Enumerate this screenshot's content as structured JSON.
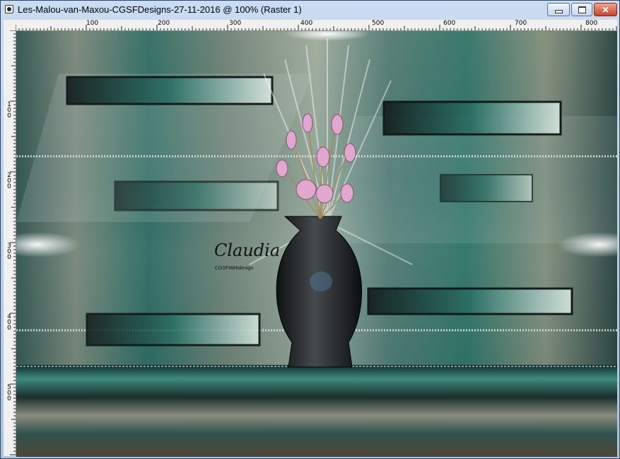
{
  "window": {
    "title": "Les-Malou-van-Maxou-CGSFDesigns-27-11-2016 @ 100% (Raster 1)",
    "minimize_label": "",
    "maximize_label": "",
    "close_label": "✕"
  },
  "ruler": {
    "top_labels": [
      "100",
      "200",
      "300",
      "400",
      "500",
      "600",
      "700",
      "800"
    ],
    "left_labels": [
      "100",
      "200",
      "300",
      "400",
      "500"
    ]
  },
  "artwork": {
    "signature": "Claudia",
    "signature_sub": "CGSFWebdesign",
    "colors": {
      "teal": "#2d6e66",
      "beige": "#b5aa92",
      "dark": "#1c2524",
      "flower": "#e0a8cf"
    }
  }
}
